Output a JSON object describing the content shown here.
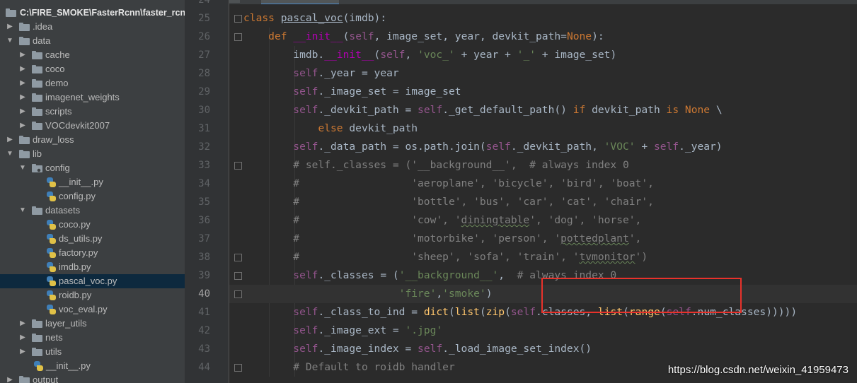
{
  "project_tree": {
    "root": "C:\\FIRE_SMOKE\\FasterRcnn\\faster_rcn",
    "items": [
      {
        "label": ".idea",
        "type": "folder",
        "expanded": false
      },
      {
        "label": "data",
        "type": "folder",
        "expanded": true
      },
      {
        "label": "cache",
        "type": "folder",
        "expanded": false
      },
      {
        "label": "coco",
        "type": "folder",
        "expanded": false
      },
      {
        "label": "demo",
        "type": "folder",
        "expanded": false
      },
      {
        "label": "imagenet_weights",
        "type": "folder",
        "expanded": false
      },
      {
        "label": "scripts",
        "type": "folder",
        "expanded": false
      },
      {
        "label": "VOCdevkit2007",
        "type": "folder",
        "expanded": false
      },
      {
        "label": "draw_loss",
        "type": "folder",
        "expanded": false
      },
      {
        "label": "lib",
        "type": "folder",
        "expanded": true
      },
      {
        "label": "config",
        "type": "package",
        "expanded": true
      },
      {
        "label": "__init__.py",
        "type": "python-file"
      },
      {
        "label": "config.py",
        "type": "python-file"
      },
      {
        "label": "datasets",
        "type": "folder",
        "expanded": true
      },
      {
        "label": "coco.py",
        "type": "python-file"
      },
      {
        "label": "ds_utils.py",
        "type": "python-file"
      },
      {
        "label": "factory.py",
        "type": "python-file"
      },
      {
        "label": "imdb.py",
        "type": "python-file"
      },
      {
        "label": "pascal_voc.py",
        "type": "python-file",
        "selected": true
      },
      {
        "label": "roidb.py",
        "type": "python-file"
      },
      {
        "label": "voc_eval.py",
        "type": "python-file"
      },
      {
        "label": "layer_utils",
        "type": "folder",
        "expanded": false
      },
      {
        "label": "nets",
        "type": "folder",
        "expanded": false
      },
      {
        "label": "utils",
        "type": "folder",
        "expanded": false
      },
      {
        "label": "__init__.py",
        "type": "python-file"
      },
      {
        "label": "output",
        "type": "folder",
        "expanded": false
      }
    ]
  },
  "editor": {
    "current_line": "40",
    "lines": [
      {
        "n": "24",
        "t": ""
      },
      {
        "n": "25",
        "t": "class pascal_voc(imdb):"
      },
      {
        "n": "26",
        "t": "    def __init__(self, image_set, year, devkit_path=None):"
      },
      {
        "n": "27",
        "t": "        imdb.__init__(self, 'voc_' + year + '_' + image_set)"
      },
      {
        "n": "28",
        "t": "        self._year = year"
      },
      {
        "n": "29",
        "t": "        self._image_set = image_set"
      },
      {
        "n": "30",
        "t": "        self._devkit_path = self._get_default_path() if devkit_path is None \\"
      },
      {
        "n": "31",
        "t": "            else devkit_path"
      },
      {
        "n": "32",
        "t": "        self._data_path = os.path.join(self._devkit_path, 'VOC' + self._year)"
      },
      {
        "n": "33",
        "t": "        # self._classes = ('__background__',  # always index 0"
      },
      {
        "n": "34",
        "t": "        #                  'aeroplane', 'bicycle', 'bird', 'boat',"
      },
      {
        "n": "35",
        "t": "        #                  'bottle', 'bus', 'car', 'cat', 'chair',"
      },
      {
        "n": "36",
        "t": "        #                  'cow', 'diningtable', 'dog', 'horse',"
      },
      {
        "n": "37",
        "t": "        #                  'motorbike', 'person', 'pottedplant',"
      },
      {
        "n": "38",
        "t": "        #                  'sheep', 'sofa', 'train', 'tvmonitor')"
      },
      {
        "n": "39",
        "t": "        self._classes = ('__background__',  # always index 0"
      },
      {
        "n": "40",
        "t": "                         'fire','smoke')"
      },
      {
        "n": "41",
        "t": "        self._class_to_ind = dict(list(zip(self.classes, list(range(self.num_classes)))))"
      },
      {
        "n": "42",
        "t": "        self._image_ext = '.jpg'"
      },
      {
        "n": "43",
        "t": "        self._image_index = self._load_image_set_index()"
      },
      {
        "n": "44",
        "t": "        # Default to roidb handler"
      }
    ]
  },
  "watermark": "https://blog.csdn.net/weixin_41959473",
  "colors": {
    "highlight_box": "#e8322b",
    "keyword": "#cc7832",
    "self": "#94558d",
    "string": "#6a8759",
    "comment": "#808080",
    "function": "#ffc66d"
  }
}
